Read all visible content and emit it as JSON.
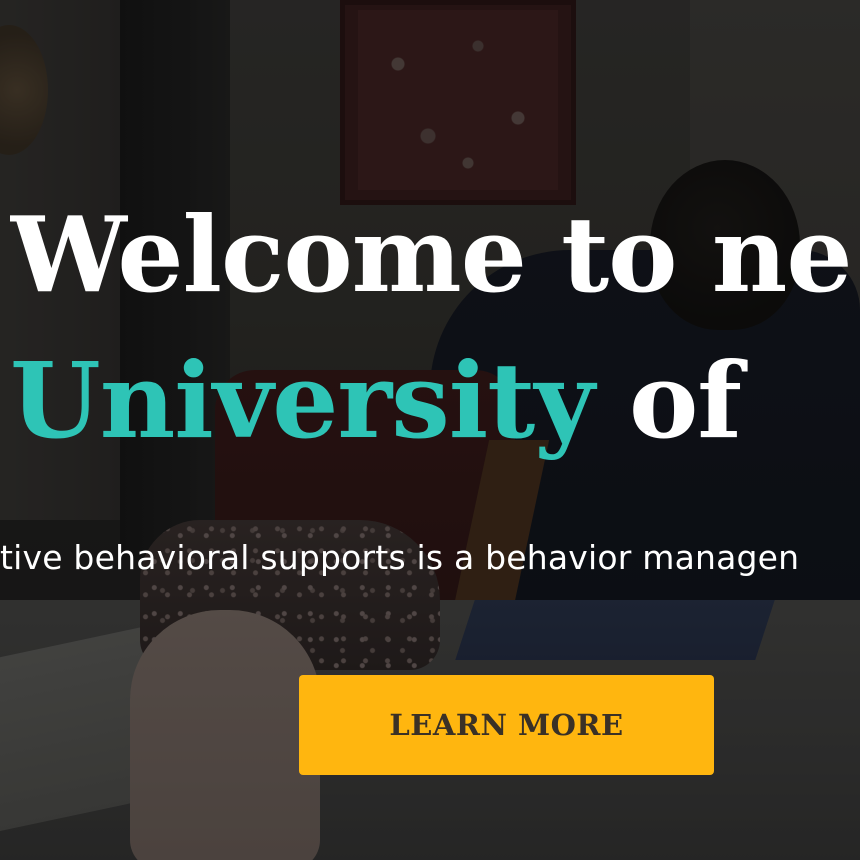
{
  "hero": {
    "heading_line1": "Welcome to ne",
    "heading_line2_accent": "University",
    "heading_line2_rest": " of",
    "subtitle": "tive behavioral supports is a behavior managen",
    "cta_label": "LEARN MORE"
  },
  "colors": {
    "accent": "#2ec4b6",
    "cta_background": "#ffb60f",
    "cta_text": "#3a3126",
    "heading_text": "#ffffff"
  }
}
